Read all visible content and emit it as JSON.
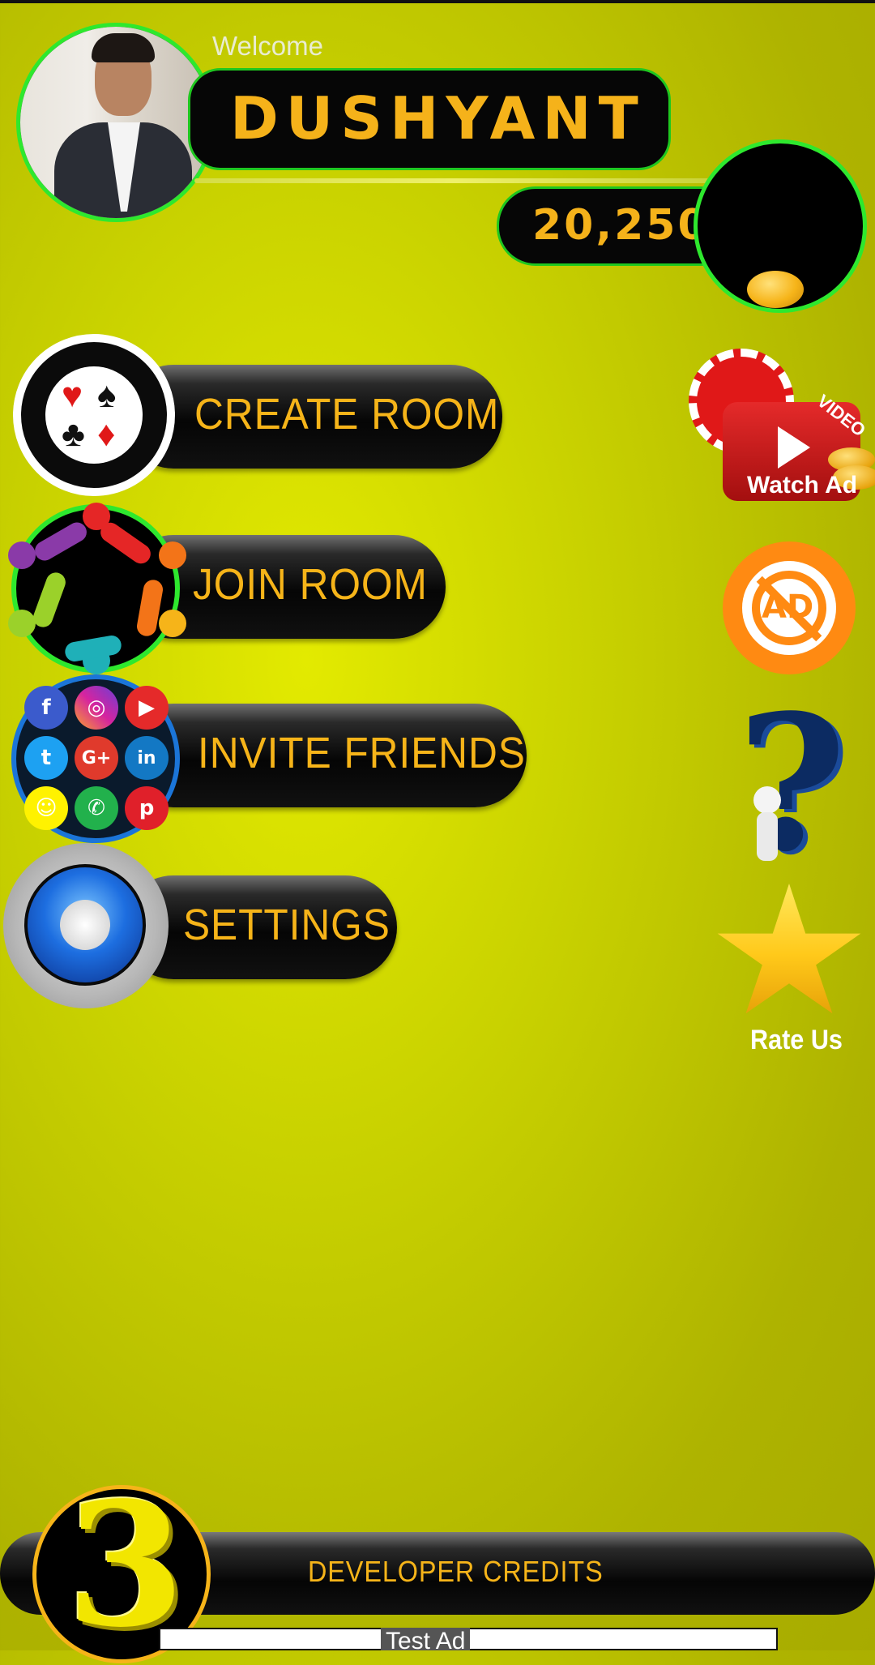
{
  "header": {
    "welcome": "Welcome",
    "username": "DUSHYANT",
    "coins": "20,250"
  },
  "menu": {
    "create_room": "CREATE ROOM",
    "join_room": "JOIN ROOM",
    "invite_friends": "INVITE FRIENDS",
    "settings": "SETTINGS"
  },
  "side": {
    "watch_ad": "Watch Ad",
    "video_tag": "VIDEO",
    "no_ad": "AD",
    "rate_us": "Rate Us"
  },
  "footer": {
    "developer_credits": "DEVELOPER CREDITS",
    "logo_digit": "3",
    "ad_label": "Test Ad"
  },
  "social_icons": [
    "facebook-icon",
    "instagram-icon",
    "youtube-icon",
    "twitter-icon",
    "google-plus-icon",
    "linkedin-icon",
    "snapchat-icon",
    "whatsapp-icon",
    "pinterest-icon"
  ],
  "colors": {
    "accent_gold": "#f6b419",
    "ring_green": "#2ee82e",
    "background": "#c9d200"
  }
}
